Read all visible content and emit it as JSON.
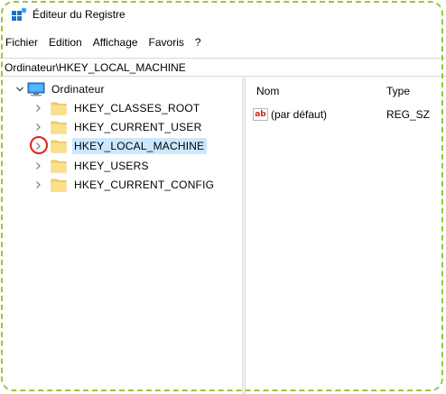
{
  "window": {
    "title": "Éditeur du Registre",
    "app_icon": "registry-editor-icon"
  },
  "menu": [
    "Fichier",
    "Edition",
    "Affichage",
    "Favoris",
    "?"
  ],
  "address": {
    "value": "Ordinateur\\HKEY_LOCAL_MACHINE"
  },
  "tree": {
    "root": {
      "label": "Ordinateur",
      "icon": "computer-icon",
      "expanded": true
    },
    "items": [
      {
        "label": "HKEY_CLASSES_ROOT",
        "icon": "folder-icon",
        "selected": false
      },
      {
        "label": "HKEY_CURRENT_USER",
        "icon": "folder-icon",
        "selected": false
      },
      {
        "label": "HKEY_LOCAL_MACHINE",
        "icon": "folder-icon",
        "selected": true,
        "annotated": true
      },
      {
        "label": "HKEY_USERS",
        "icon": "folder-icon",
        "selected": false
      },
      {
        "label": "HKEY_CURRENT_CONFIG",
        "icon": "folder-icon",
        "selected": false
      }
    ]
  },
  "list": {
    "columns": [
      "Nom",
      "Type"
    ],
    "rows": [
      {
        "name": "(par défaut)",
        "type": "REG_SZ",
        "icon": "string-value-icon"
      }
    ]
  },
  "colors": {
    "selection": "#cce8ff",
    "folder": "#f7d26b",
    "annotation": "#e0201b",
    "border_dash": "#9bc53d"
  }
}
